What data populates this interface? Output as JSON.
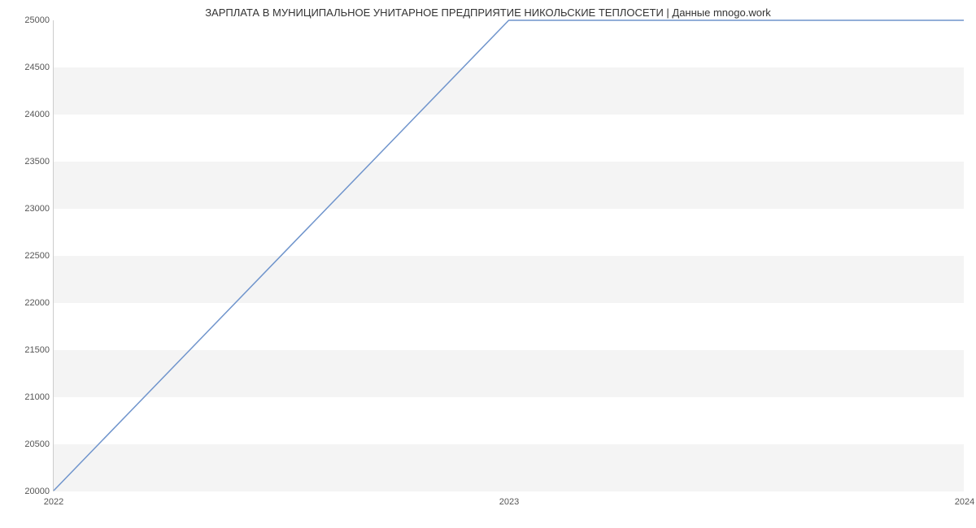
{
  "chart_data": {
    "type": "line",
    "title": "ЗАРПЛАТА В МУНИЦИПАЛЬНОЕ УНИТАРНОЕ ПРЕДПРИЯТИЕ НИКОЛЬСКИЕ ТЕПЛОСЕТИ | Данные mnogo.work",
    "x": [
      2022,
      2023,
      2024
    ],
    "values": [
      20000,
      25000,
      25000
    ],
    "xlabel": "",
    "ylabel": "",
    "xticks": [
      "2022",
      "2023",
      "2024"
    ],
    "yticks": [
      "20000",
      "20500",
      "21000",
      "21500",
      "22000",
      "22500",
      "23000",
      "23500",
      "24000",
      "24500",
      "25000"
    ],
    "ylim": [
      20000,
      25000
    ],
    "xlim": [
      2022,
      2024
    ],
    "line_color": "#6f94cc"
  }
}
